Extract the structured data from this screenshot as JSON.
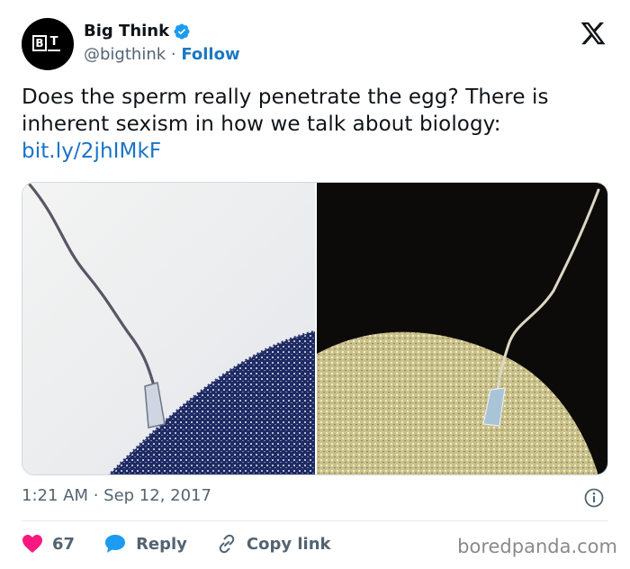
{
  "account": {
    "display_name": "Big Think",
    "handle": "@bigthink",
    "separator": " · ",
    "follow_label": "Follow",
    "avatar_text_b": "B",
    "avatar_text_t": "T",
    "verified_icon": "verified-badge",
    "verified_color": "#1d9bf0"
  },
  "tweet": {
    "text": "Does the sperm really penetrate the egg? There is inherent sexism in how we talk about biology:",
    "link": "bit.ly/2jhIMkF",
    "timestamp": "1:21 AM · Sep 12, 2017"
  },
  "actions": {
    "likes": "67",
    "reply_label": "Reply",
    "copy_link_label": "Copy link",
    "like_color": "#f91880",
    "reply_color": "#1d9bf0"
  },
  "watermark": "boredpanda.com"
}
